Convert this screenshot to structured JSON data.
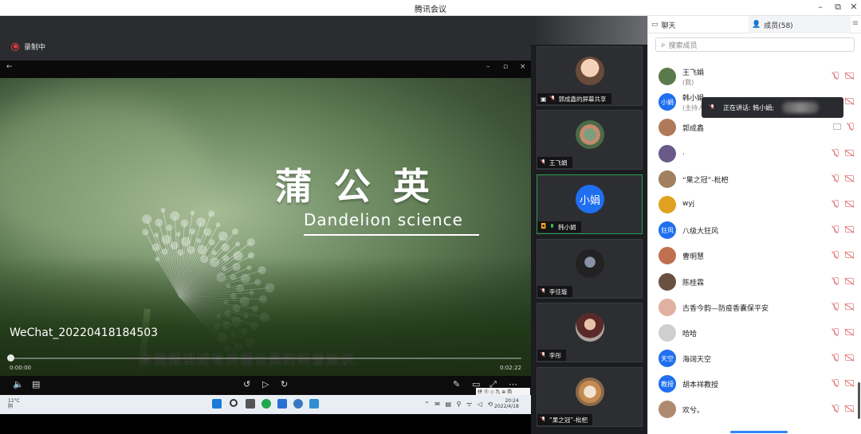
{
  "window": {
    "title": "腾讯会议"
  },
  "recording": {
    "label": "录制中"
  },
  "share_window": {
    "back": "←",
    "min": "–",
    "max": "▫",
    "close": "×"
  },
  "video": {
    "title_zh": "蒲公英",
    "title_en": "Dandelion  science",
    "watermark": "WeChat_20220418184503",
    "subtitle": "本视频讲述有关蒲公英的科普知识",
    "time_current": "0:00:00",
    "time_total": "0:02:22",
    "progress": 0.0
  },
  "taskbar": {
    "weather_temp": "11°C",
    "weather_desc": "阴",
    "time": "20:24",
    "date": "2022/4/18",
    "ime": "拼 ⑪ ◇ 九 ⊕ 简"
  },
  "thumbnails": [
    {
      "name": "郭成鑫的屏幕共享",
      "avatar": "photo-child",
      "mic": "muted",
      "icon": "screen-share-icon"
    },
    {
      "name": "王飞娟",
      "avatar": "photo-kids",
      "mic": "muted"
    },
    {
      "name": "韩小娟",
      "avatar_text": "小娟",
      "avatar_color": "#1f6ff0",
      "mic": "active",
      "active": true
    },
    {
      "name": "李佳璇",
      "avatar": "photo-dark",
      "mic": "muted"
    },
    {
      "name": "李彤",
      "avatar": "photo-woman",
      "mic": "muted"
    },
    {
      "name": "“果之冠”-枇杷",
      "avatar": "photo-dog",
      "mic": "muted"
    }
  ],
  "panel": {
    "tab_chat": "聊天",
    "tab_members": "成员(58)",
    "search_placeholder": "搜索成员",
    "speaking_tip": "正在讲话: 韩小娟;"
  },
  "members": [
    {
      "name": "王飞娟",
      "role": "(我)",
      "avatar_color": "#5a7a4c"
    },
    {
      "name": "韩小娟",
      "role": "(主持人)",
      "avatar_text": "小娟",
      "avatar_color": "#1f6ff0"
    },
    {
      "name": "郭成鑫",
      "avatar_color": "#b07a5a",
      "sharing": true
    },
    {
      "name": ".",
      "avatar_color": "#6a5a8a"
    },
    {
      "name": "“果之冠”-枇杷",
      "avatar_color": "#a08060"
    },
    {
      "name": "wyj",
      "avatar_color": "#e0a020"
    },
    {
      "name": "八级大狂风",
      "avatar_text": "狂风",
      "avatar_color": "#1f6ff0"
    },
    {
      "name": "曹明慧",
      "avatar_color": "#c07050"
    },
    {
      "name": "陈桂霖",
      "avatar_color": "#6a5040"
    },
    {
      "name": "古香今韵—防疫香囊保平安",
      "avatar_color": "#e0b0a0"
    },
    {
      "name": "哈哈",
      "avatar_color": "#cfcfcf"
    },
    {
      "name": "海阔天空",
      "avatar_text": "天空",
      "avatar_color": "#1f6ff0"
    },
    {
      "name": "胡本祥教授",
      "avatar_text": "教授",
      "avatar_color": "#1f6ff0"
    },
    {
      "name": "欢兮。",
      "avatar_color": "#b08a70"
    }
  ]
}
